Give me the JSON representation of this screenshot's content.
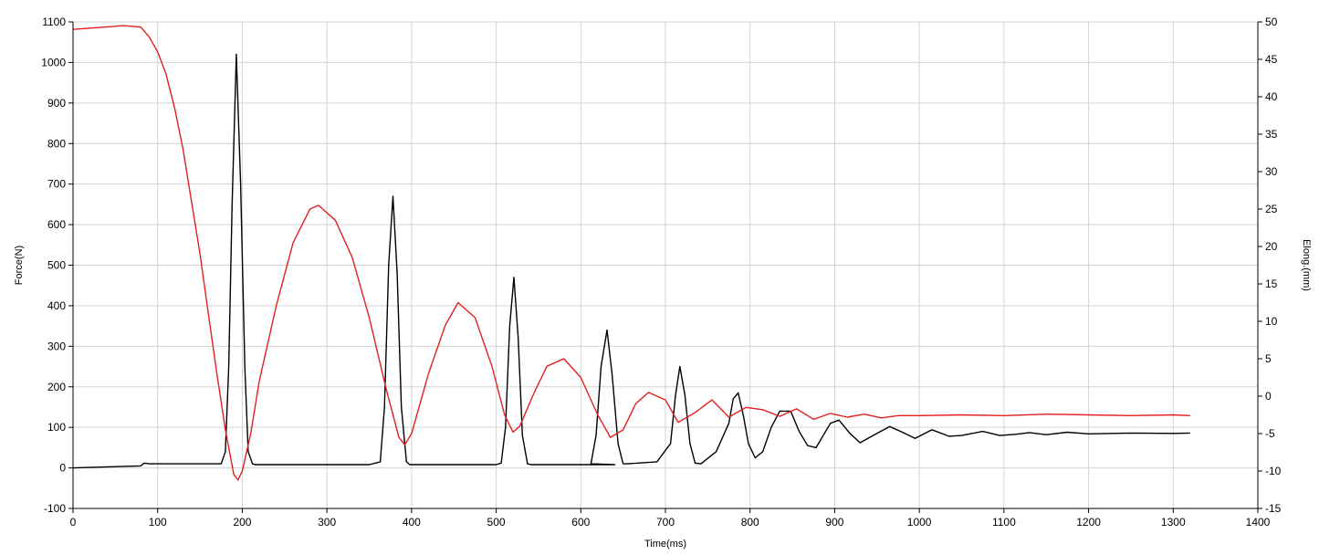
{
  "chart_data": {
    "type": "line",
    "xlabel": "Time(ms)",
    "ylabel": "Force(N)",
    "y2label": "Elong.(mm)",
    "xlim": [
      0,
      1400
    ],
    "ylim": [
      -100,
      1100
    ],
    "y2lim": [
      -15,
      50
    ],
    "grid": true,
    "x_ticks": [
      0,
      100,
      200,
      300,
      400,
      500,
      600,
      700,
      800,
      900,
      1000,
      1100,
      1200,
      1300,
      1400
    ],
    "y_ticks": [
      -100,
      0,
      100,
      200,
      300,
      400,
      500,
      600,
      700,
      800,
      900,
      1000,
      1100
    ],
    "y2_ticks": [
      -15,
      -10,
      -5,
      0,
      5,
      10,
      15,
      20,
      25,
      30,
      35,
      40,
      45,
      50
    ],
    "series": [
      {
        "axis": "left",
        "color": "#000000",
        "x": [
          0,
          80,
          84,
          90,
          120,
          150,
          175,
          180,
          184,
          188,
          193,
          198,
          203,
          207,
          212,
          215,
          250,
          300,
          350,
          363,
          368,
          373,
          378,
          383,
          388,
          394,
          398,
          450,
          500,
          506,
          511,
          516,
          521,
          526,
          531,
          537,
          541,
          600,
          640,
          612,
          618,
          624,
          631,
          637,
          644,
          650,
          655,
          690,
          706,
          712,
          717,
          723,
          729,
          735,
          742,
          760,
          775,
          780,
          786,
          792,
          798,
          806,
          815,
          825,
          835,
          848,
          858,
          868,
          878,
          895,
          905,
          918,
          930,
          950,
          965,
          980,
          995,
          1015,
          1035,
          1050,
          1075,
          1095,
          1115,
          1130,
          1150,
          1175,
          1200,
          1250,
          1300,
          1320
        ],
        "y": [
          0,
          5,
          12,
          10,
          10,
          10,
          10,
          40,
          250,
          650,
          1020,
          700,
          250,
          40,
          10,
          8,
          8,
          8,
          8,
          15,
          150,
          500,
          670,
          480,
          150,
          15,
          8,
          8,
          8,
          12,
          100,
          350,
          470,
          320,
          80,
          10,
          8,
          8,
          8,
          10,
          80,
          250,
          340,
          230,
          60,
          10,
          10,
          15,
          60,
          180,
          250,
          180,
          60,
          12,
          10,
          40,
          110,
          170,
          185,
          130,
          60,
          25,
          40,
          100,
          140,
          140,
          90,
          55,
          50,
          110,
          118,
          85,
          62,
          85,
          102,
          88,
          73,
          94,
          78,
          80,
          90,
          80,
          83,
          87,
          82,
          88,
          84,
          86,
          85,
          86
        ]
      },
      {
        "axis": "right",
        "color": "#e32020",
        "x": [
          0,
          60,
          80,
          90,
          100,
          110,
          120,
          130,
          140,
          150,
          160,
          170,
          180,
          190,
          195,
          200,
          210,
          220,
          240,
          260,
          280,
          290,
          310,
          330,
          350,
          370,
          385,
          392,
          400,
          420,
          440,
          455,
          475,
          495,
          510,
          520,
          528,
          545,
          560,
          580,
          600,
          620,
          635,
          650,
          665,
          680,
          700,
          715,
          735,
          755,
          775,
          795,
          815,
          835,
          855,
          875,
          895,
          915,
          935,
          955,
          975,
          1000,
          1050,
          1100,
          1150,
          1200,
          1250,
          1300,
          1320
        ],
        "y": [
          49.0,
          49.5,
          49.3,
          48.0,
          46.0,
          43.0,
          38.5,
          33.0,
          26.0,
          19.0,
          11.0,
          3.0,
          -4.5,
          -10.5,
          -11.2,
          -10.0,
          -5.0,
          2.0,
          12.0,
          20.5,
          25.0,
          25.5,
          23.5,
          18.5,
          10.5,
          1.0,
          -5.5,
          -6.5,
          -5.0,
          3.0,
          9.5,
          12.5,
          10.5,
          4.0,
          -2.5,
          -4.8,
          -4.0,
          0.5,
          4.0,
          5.0,
          2.5,
          -2.5,
          -5.5,
          -4.5,
          -1.0,
          0.5,
          -0.5,
          -3.5,
          -2.2,
          -0.5,
          -2.8,
          -1.5,
          -1.8,
          -2.7,
          -1.7,
          -3.1,
          -2.3,
          -2.8,
          -2.4,
          -2.9,
          -2.6,
          -2.6,
          -2.5,
          -2.6,
          -2.4,
          -2.5,
          -2.6,
          -2.5,
          -2.6
        ]
      }
    ]
  }
}
